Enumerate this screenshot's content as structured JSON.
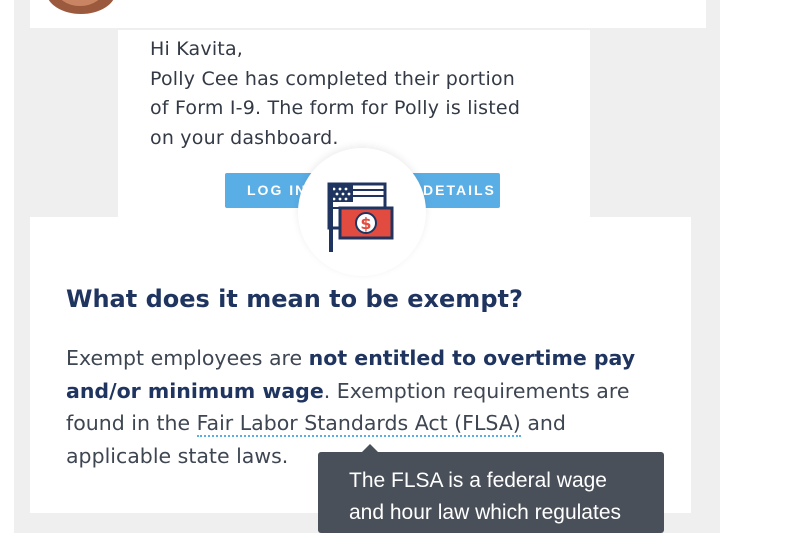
{
  "email": {
    "greeting": "Hi Kavita,",
    "body_lines": [
      "Polly Cee has completed their portion",
      "of Form I-9. The form for Polly is listed",
      "on your dashboard."
    ],
    "login_button": "LOG IN",
    "details_button": "DETAILS"
  },
  "info": {
    "icon": "flag-money-icon",
    "heading": "What does it mean to be exempt?",
    "para": {
      "l1_a": "Exempt employees are ",
      "l1_b": "not entitled to overtime pay",
      "l2_a": "and/or minimum wage",
      "l2_b": ". Exemption requirements are",
      "l3_a": "found in the ",
      "l3_link": "Fair Labor Standards Act (FLSA)",
      "l3_b": " and",
      "l4": "applicable state laws."
    }
  },
  "tooltip": {
    "lines": [
      "The FLSA is a federal wage",
      "and hour law which regulates"
    ]
  },
  "colors": {
    "accent": "#5aaee6",
    "heading": "#1f3560",
    "tooltip_bg": "#4a5059",
    "money_red": "#e24b3f"
  }
}
